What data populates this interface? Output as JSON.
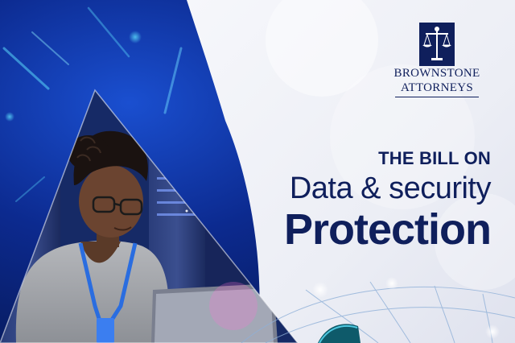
{
  "brand": {
    "name_line1": "BROWNSTONE",
    "name_line2": "ATTORNEYS",
    "logo_icon": "scales-of-justice-icon",
    "color": "#0f1f5c"
  },
  "headline": {
    "kicker": "THE BILL ON",
    "line2": "Data & security",
    "line3": "Protection"
  },
  "photo": {
    "subject": "woman-with-laptop-in-server-room",
    "lanyard_color": "#2a6de0"
  },
  "colors": {
    "navy": "#0a1a5c",
    "deep_blue": "#0b2a8a",
    "light_bg": "#eef0f6",
    "text_navy": "#0f1f5c"
  }
}
